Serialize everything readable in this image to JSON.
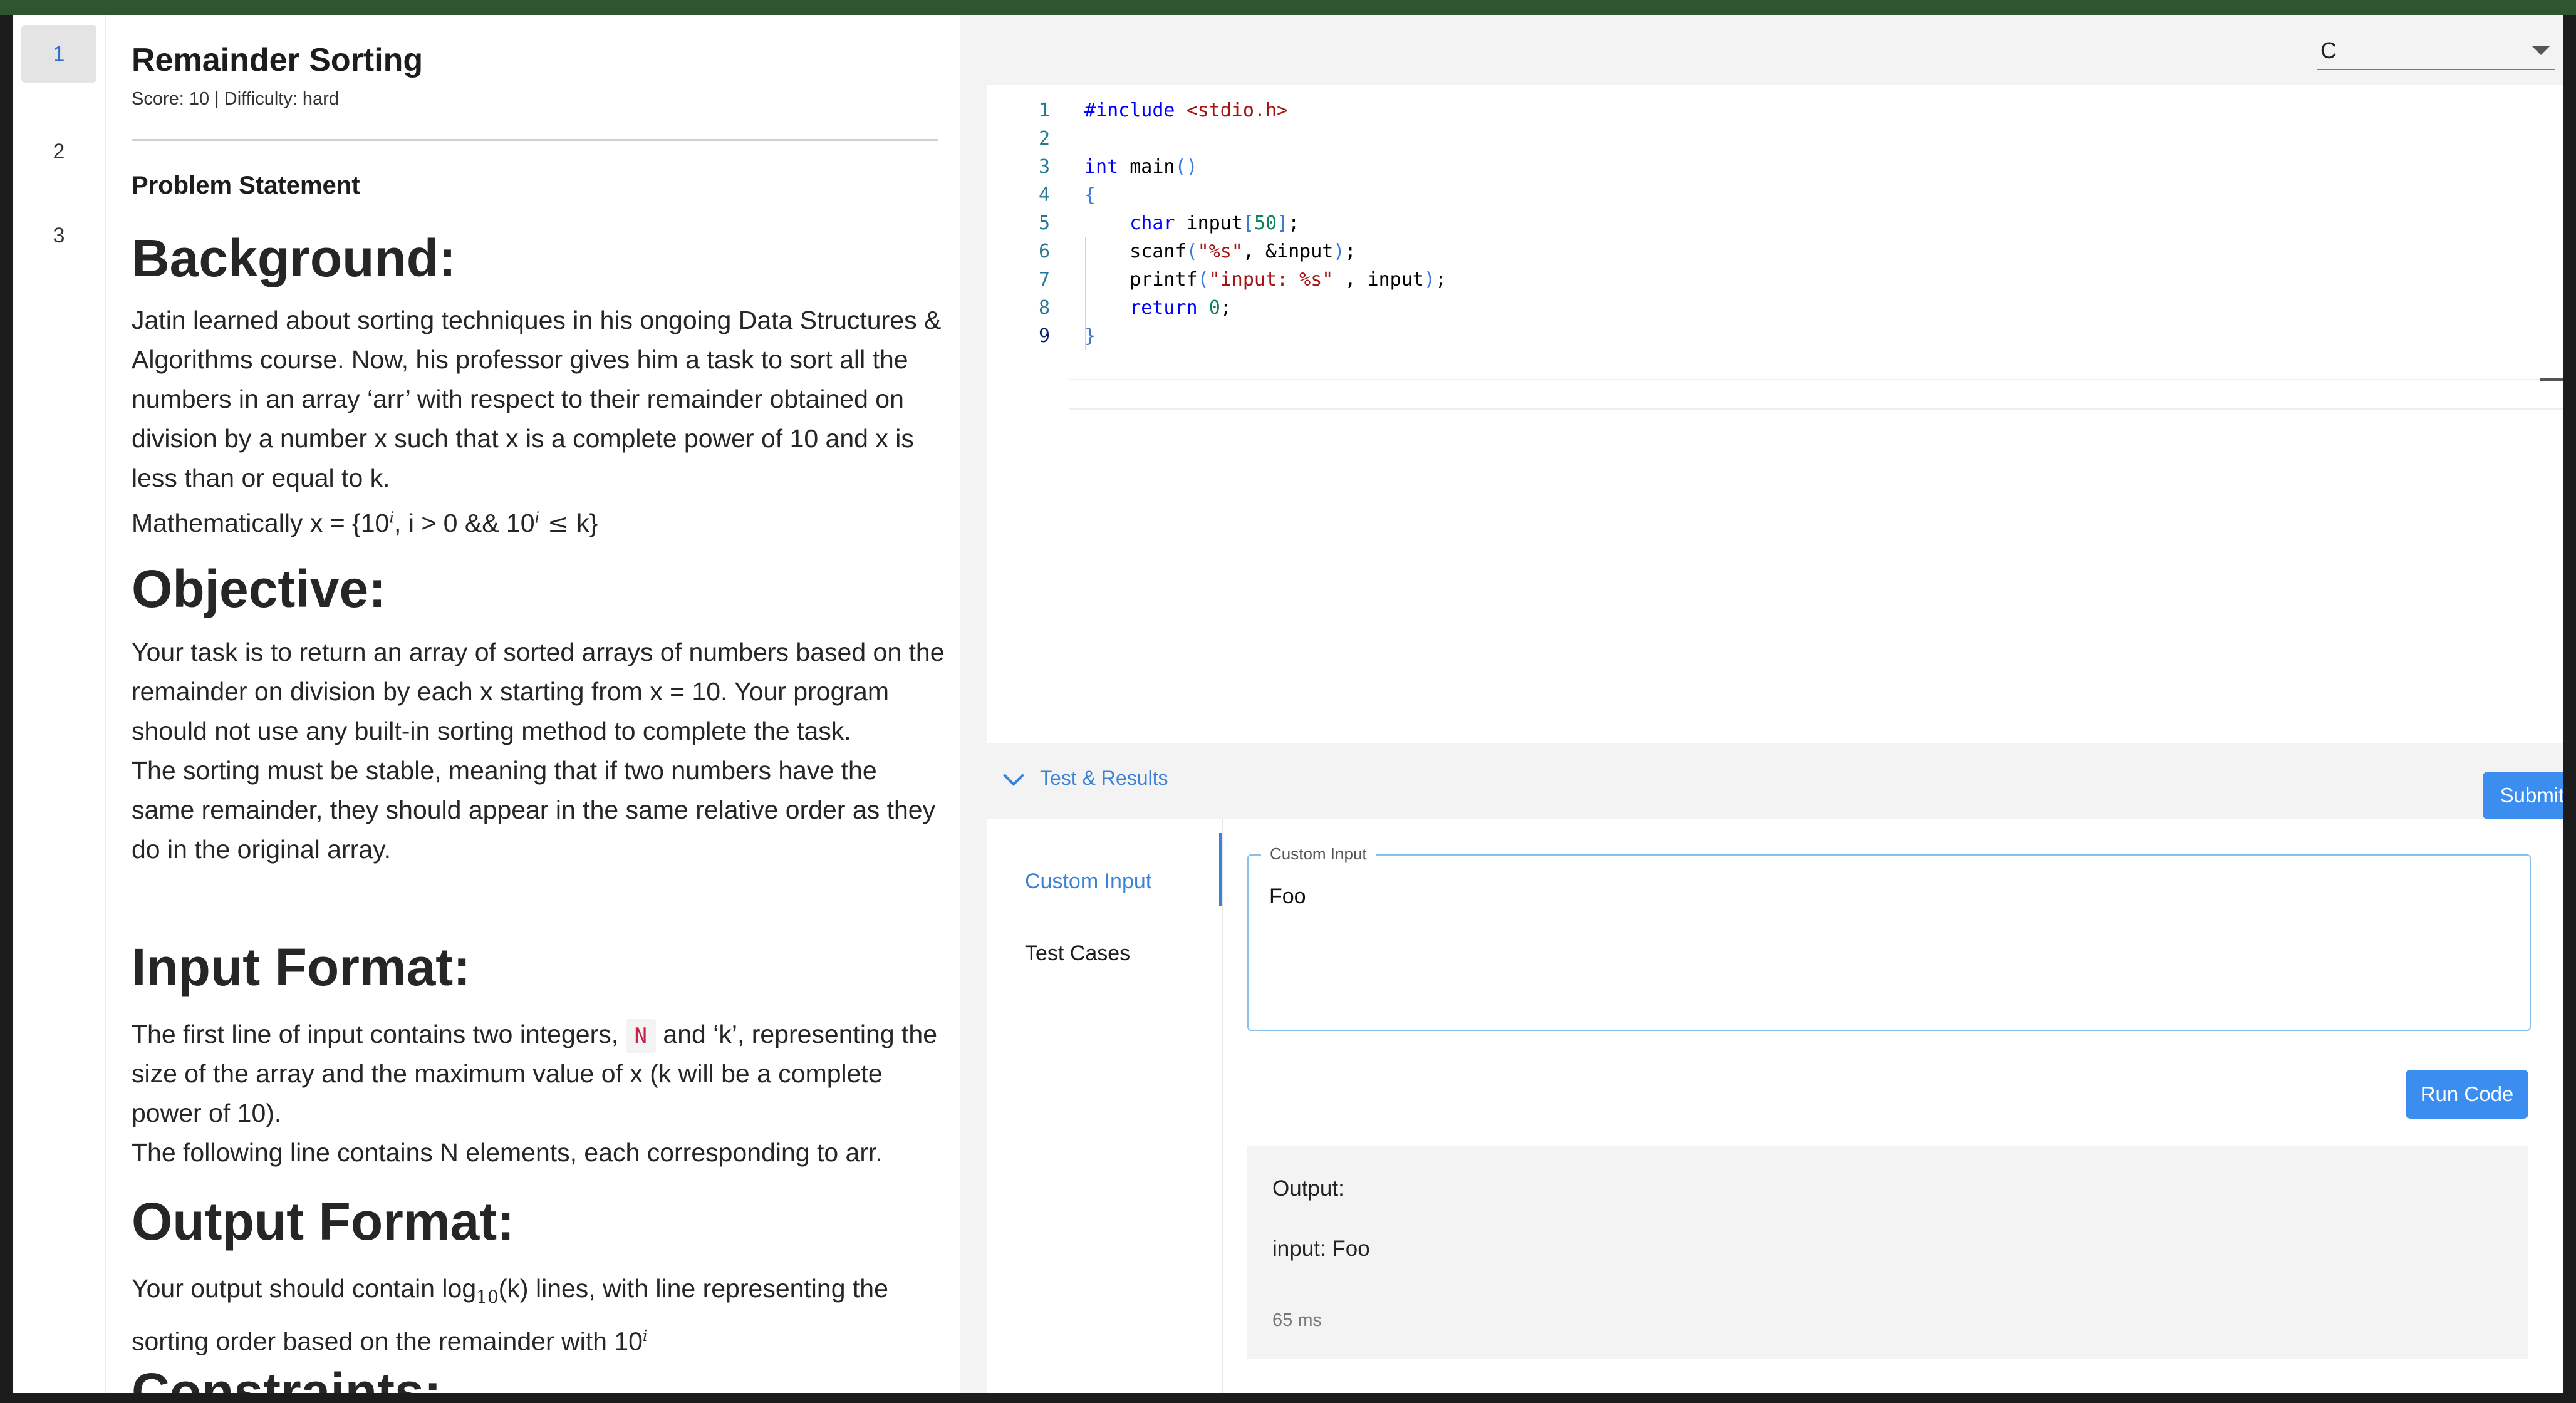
{
  "nav": {
    "questions": [
      "1",
      "2",
      "3"
    ],
    "active": "1"
  },
  "problem": {
    "title": "Remainder Sorting",
    "meta": "Score: 10 | Difficulty: hard",
    "section_label": "Problem Statement",
    "background_heading": "Background:",
    "background_text": "Jatin learned about sorting techniques in his ongoing Data Structures & Algorithms course. Now, his professor gives him a task to sort all the numbers in an array ‘arr’ with respect to their remainder obtained on division by a number x such that x is a complete power of 10 and x is less than or equal to k.",
    "math_prefix": "Mathematically x = {10",
    "math_sup1": "i",
    "math_mid": ", i > 0 && 10",
    "math_sup2": "i",
    "math_le": " ≤ ",
    "math_suffix": "k}",
    "objective_heading": "Objective:",
    "objective_text1": "Your task is to return an array of sorted arrays of numbers based on the remainder on division by each x starting from x = 10. Your program should not use any built-in sorting method to complete the task.",
    "objective_text2": "The sorting must be stable, meaning that if two numbers have the same remainder, they should appear in the same relative order as they do in the original array.",
    "input_heading": "Input Format:",
    "input_text_a": "The first line of input contains two integers,",
    "input_chip": "N",
    "input_text_b": "and ‘k’, representing the size of the array and the maximum value of x (k will be a complete power of 10).",
    "input_text2": "The following line contains N elements, each corresponding to arr.",
    "output_heading": "Output Format:",
    "output_text_a": "Your output should contain log",
    "output_sub": "10",
    "output_text_b": "(k) lines, with line representing the sorting order based on the remainder with 10",
    "output_sup": "i",
    "constraints_heading": "Constraints:"
  },
  "editor": {
    "language": "C",
    "line_numbers": [
      "1",
      "2",
      "3",
      "4",
      "5",
      "6",
      "7",
      "8",
      "9"
    ],
    "current_line": "9"
  },
  "results": {
    "toggle_label": "Test & Results",
    "submit_label": "Submit",
    "tabs": [
      "Custom Input",
      "Test Cases"
    ],
    "custom_input_legend": "Custom Input",
    "custom_input_value": "Foo",
    "run_label": "Run Code",
    "output_label": "Output:",
    "output_value": "input: Foo",
    "runtime": "65 ms"
  },
  "colors": {
    "accent": "#3b8ef0",
    "topbar": "#2f5530"
  }
}
